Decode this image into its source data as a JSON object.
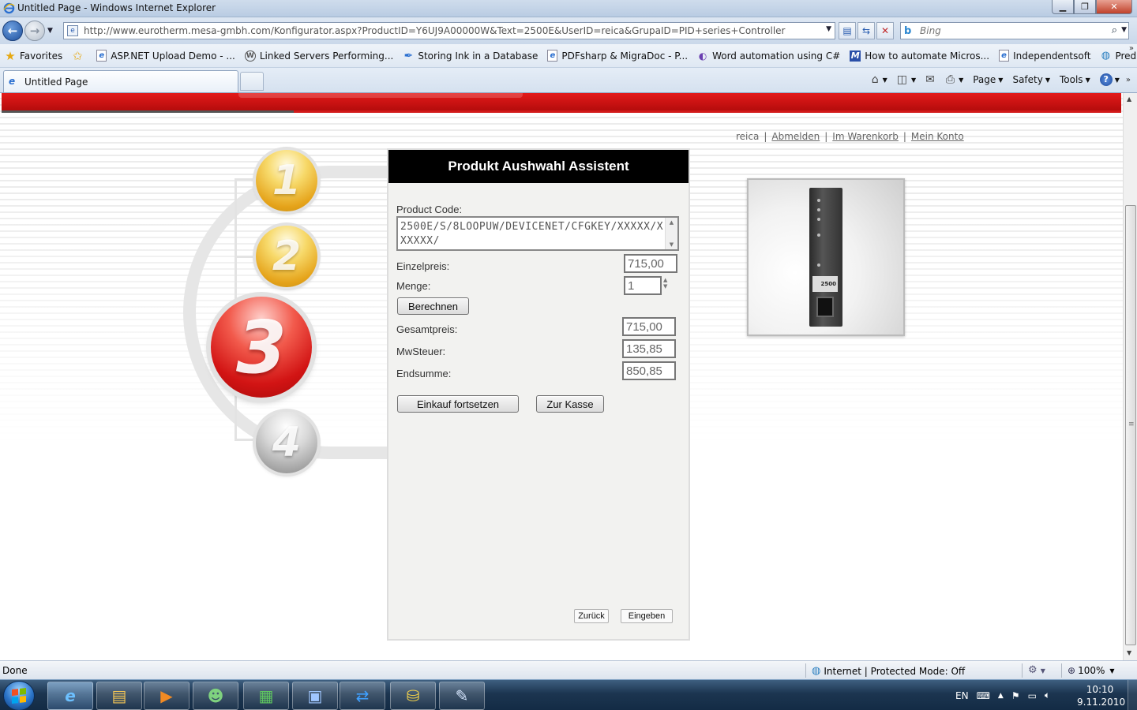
{
  "window": {
    "title": "Untitled Page - Windows Internet Explorer",
    "minimize_icon": "minimize-icon",
    "maximize_icon": "maximize-icon",
    "close_icon": "close-icon"
  },
  "address_bar": {
    "url": "http://www.eurotherm.mesa-gmbh.com/Konfigurator.aspx?ProductID=Y6UJ9A00000W&Text=2500E&UserID=reica&GrupaID=PID+series+Controller"
  },
  "search": {
    "placeholder": "Bing"
  },
  "favorites_bar": {
    "favorites_label": "Favorites",
    "items": [
      {
        "label": "ASP.NET Upload Demo - ...",
        "icon": "ie-page-icon"
      },
      {
        "label": "Linked Servers Performing...",
        "icon": "wordpress-icon"
      },
      {
        "label": "Storing Ink in a Database",
        "icon": "ink-icon"
      },
      {
        "label": "PDFsharp & MigraDoc - P...",
        "icon": "ie-page-icon"
      },
      {
        "label": "Word automation using C#",
        "icon": "word-icon"
      },
      {
        "label": "How to automate Micros...",
        "icon": "msdn-icon"
      },
      {
        "label": "Independentsoft",
        "icon": "ie-page-icon"
      },
      {
        "label": "Predložene lokacije",
        "icon": "ie-globe-icon"
      }
    ]
  },
  "tabs": [
    {
      "label": "Untitled Page"
    }
  ],
  "command_bar": {
    "page": "Page",
    "safety": "Safety",
    "tools": "Tools"
  },
  "page": {
    "user_links": {
      "username": "reica",
      "logout": "Abmelden",
      "cart": "Im Warenkorb",
      "account": "Mein Konto"
    },
    "steps": [
      "1",
      "2",
      "3",
      "4"
    ],
    "active_step": 3,
    "wizard": {
      "title": "Produkt Aushwahl Assistent",
      "product_code_label": "Product Code:",
      "product_code_value": "2500E/S/8LOOPUW/DEVICENET/CFGKEY/XXXXX/XXXXXX/",
      "unit_price_label": "Einzelpreis:",
      "unit_price_value": "715,00",
      "quantity_label": "Menge:",
      "quantity_value": "1",
      "calculate_button": "Berechnen",
      "total_price_label": "Gesamtpreis:",
      "total_price_value": "715,00",
      "vat_label": "MwSteuer:",
      "vat_value": "135,85",
      "grand_total_label": "Endsumme:",
      "grand_total_value": "850,85",
      "continue_shopping_button": "Einkauf fortsetzen",
      "checkout_button": "Zur Kasse",
      "back_button": "Zurück",
      "submit_button": "Eingeben"
    },
    "product_image": {
      "badge_text": "2500"
    }
  },
  "status_bar": {
    "status": "Done",
    "zone": "Internet | Protected Mode: Off",
    "zoom": "100%"
  },
  "taskbar": {
    "language": "EN",
    "time": "10:10",
    "date": "9.11.2010"
  },
  "colors": {
    "banner_red": "#d21414",
    "wizard_header": "#000000",
    "step1_gold": "#e5a31a",
    "step3_red": "#d21414",
    "step4_gray": "#9a9a9a"
  }
}
